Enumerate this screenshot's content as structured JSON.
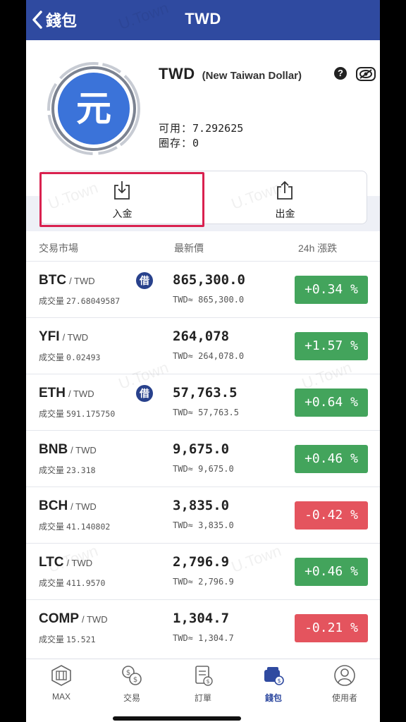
{
  "header": {
    "back_label": "錢包",
    "title": "TWD"
  },
  "currency": {
    "symbol_glyph": "元",
    "code": "TWD",
    "full_name": "(New Taiwan Dollar)",
    "help_glyph": "?",
    "available_label": "可用：",
    "available_value": "7.292625",
    "locked_label": "圈存：",
    "locked_value": "0"
  },
  "actions": {
    "deposit_label": "入金",
    "withdraw_label": "出金"
  },
  "table": {
    "headers": [
      "交易市場",
      "最新價",
      "24h 漲跌"
    ],
    "volume_label": "成交量",
    "rows": [
      {
        "base": "BTC",
        "quote": "/ TWD",
        "volume": "27.68049587",
        "badge": "借",
        "price": "865,300.0",
        "twd": "TWD≈ 865,300.0",
        "change": "+0.34 %",
        "dir": "up"
      },
      {
        "base": "YFI",
        "quote": "/ TWD",
        "volume": "0.02493",
        "badge": "",
        "price": "264,078",
        "twd": "TWD≈ 264,078.0",
        "change": "+1.57 %",
        "dir": "up"
      },
      {
        "base": "ETH",
        "quote": "/ TWD",
        "volume": "591.175750",
        "badge": "借",
        "price": "57,763.5",
        "twd": "TWD≈ 57,763.5",
        "change": "+0.64 %",
        "dir": "up"
      },
      {
        "base": "BNB",
        "quote": "/ TWD",
        "volume": "23.318",
        "badge": "",
        "price": "9,675.0",
        "twd": "TWD≈ 9,675.0",
        "change": "+0.46 %",
        "dir": "up"
      },
      {
        "base": "BCH",
        "quote": "/ TWD",
        "volume": "41.140802",
        "badge": "",
        "price": "3,835.0",
        "twd": "TWD≈ 3,835.0",
        "change": "-0.42 %",
        "dir": "down"
      },
      {
        "base": "LTC",
        "quote": "/ TWD",
        "volume": "411.9570",
        "badge": "",
        "price": "2,796.9",
        "twd": "TWD≈ 2,796.9",
        "change": "+0.46 %",
        "dir": "up"
      },
      {
        "base": "COMP",
        "quote": "/ TWD",
        "volume": "15.521",
        "badge": "",
        "price": "1,304.7",
        "twd": "TWD≈ 1,304.7",
        "change": "-0.21 %",
        "dir": "down"
      }
    ]
  },
  "tabbar": {
    "tabs": [
      {
        "label": "MAX",
        "icon": "max-logo-icon"
      },
      {
        "label": "交易",
        "icon": "exchange-icon"
      },
      {
        "label": "訂單",
        "icon": "orders-icon"
      },
      {
        "label": "錢包",
        "icon": "wallet-icon",
        "active": true
      },
      {
        "label": "使用者",
        "icon": "user-icon"
      }
    ]
  },
  "watermark": "U.Town",
  "colors": {
    "header": "#2f4aa0",
    "up": "#43a45c",
    "down": "#e4545e",
    "highlight": "#d9214f",
    "coin": "#3b73d9"
  }
}
